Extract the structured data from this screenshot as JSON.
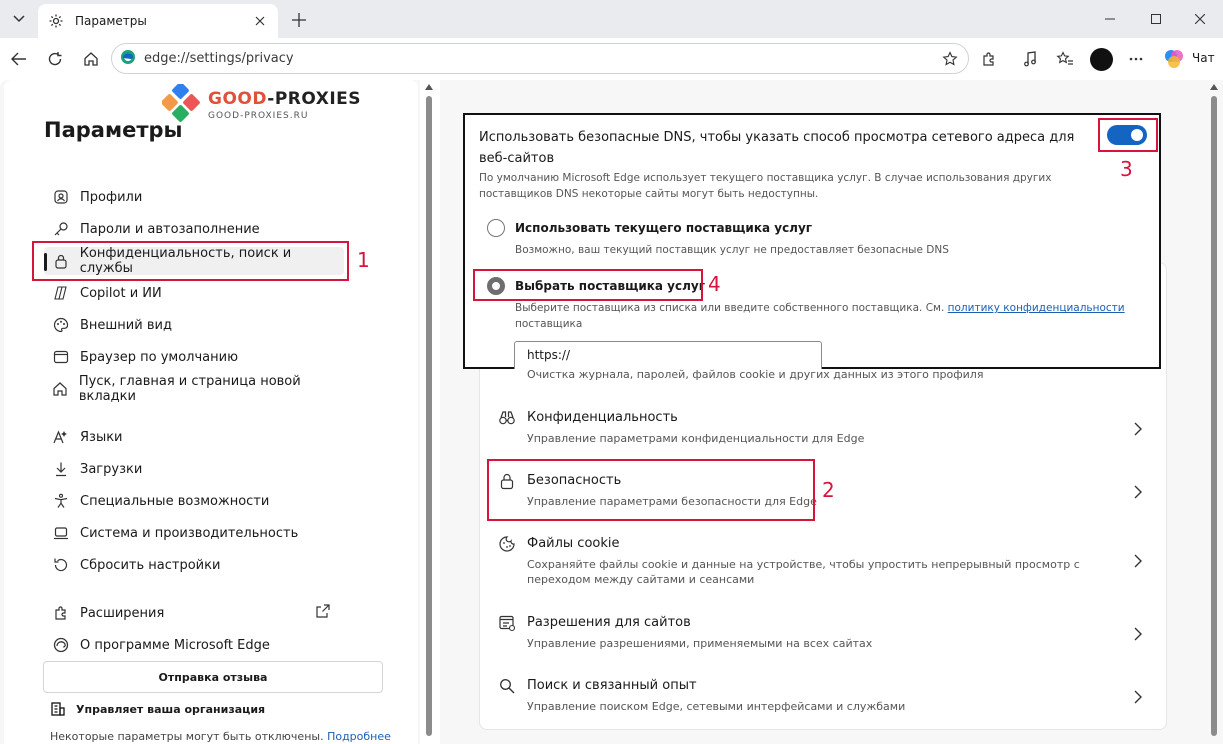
{
  "tab": {
    "title": "Параметры"
  },
  "address": {
    "url": "edge://settings/privacy"
  },
  "toolbar": {
    "chat_label": "Чат"
  },
  "brand": {
    "logo_text_1": "GOOD",
    "logo_text_2": "-PROXIES",
    "logo_sub": "GOOD-PROXIES.RU"
  },
  "sidebar": {
    "title": "Параметры",
    "items": [
      {
        "label": "Профили",
        "icon": "profile-icon"
      },
      {
        "label": "Пароли и автозаполнение",
        "icon": "key-icon"
      },
      {
        "label": "Конфиденциальность, поиск и службы",
        "icon": "lock-icon",
        "active": true
      },
      {
        "label": "Copilot и ИИ",
        "icon": "copilot-icon"
      },
      {
        "label": "Внешний вид",
        "icon": "palette-icon"
      },
      {
        "label": "Браузер по умолчанию",
        "icon": "browser-icon"
      },
      {
        "label": "Пуск, главная и страница новой вкладки",
        "icon": "home-icon"
      },
      {
        "label": "Языки",
        "icon": "language-icon"
      },
      {
        "label": "Загрузки",
        "icon": "download-icon"
      },
      {
        "label": "Специальные возможности",
        "icon": "accessibility-icon"
      },
      {
        "label": "Система и производительность",
        "icon": "laptop-icon"
      },
      {
        "label": "Сбросить настройки",
        "icon": "reset-icon"
      },
      {
        "label": "Расширения",
        "icon": "puzzle-icon"
      },
      {
        "label": "О программе Microsoft Edge",
        "icon": "edge-icon"
      }
    ],
    "feedback_label": "Отправка отзыва",
    "org_label": "Управляет ваша организация",
    "org_note": "Некоторые параметры могут быть отключены.",
    "org_link": "Подробнее"
  },
  "dns": {
    "title": "Использовать безопасные DNS, чтобы указать способ просмотра сетевого адреса для веб-сайтов",
    "description": "По умолчанию Microsoft Edge использует текущего поставщика услуг. В случае использования других поставщиков DNS некоторые сайты могут быть недоступны.",
    "enabled": true,
    "option1_title": "Использовать текущего поставщика услуг",
    "option1_sub": "Возможно, ваш текущий поставщик услуг не предоставляет безопасные DNS",
    "option2_title": "Выбрать поставщика услуг",
    "option2_sub": "Выберите поставщика из списка или введите собственного поставщика. См.",
    "option2_link": "политику конфиденциальности",
    "option2_sub2": "поставщика",
    "input_value": "https://"
  },
  "main": {
    "partial_line": "Очистка журнала, паролей, файлов cookie и других данных из этого профиля",
    "rows": [
      {
        "title": "Конфиденциальность",
        "sub": "Управление параметрами конфиденциальности для Edge",
        "icon": "binoculars-icon"
      },
      {
        "title": "Безопасность",
        "sub": "Управление параметрами безопасности для Edge",
        "icon": "lock-icon"
      },
      {
        "title": "Файлы cookie",
        "sub": "Сохраняйте файлы cookie и данные на устройстве, чтобы упростить непрерывный просмотр с",
        "sub2": "переходом между сайтами и сеансами",
        "icon": "cookie-icon"
      },
      {
        "title": "Разрешения для сайтов",
        "sub": "Управление разрешениями, применяемыми на всех сайтах",
        "icon": "site-permissions-icon"
      },
      {
        "title": "Поиск и связанный опыт",
        "sub": "Управление поиском Edge, сетевыми интерфейсами и службами",
        "icon": "search-icon"
      }
    ]
  },
  "annotations": {
    "n1": "1",
    "n2": "2",
    "n3": "3",
    "n4": "4",
    "color": "#d6143c"
  }
}
